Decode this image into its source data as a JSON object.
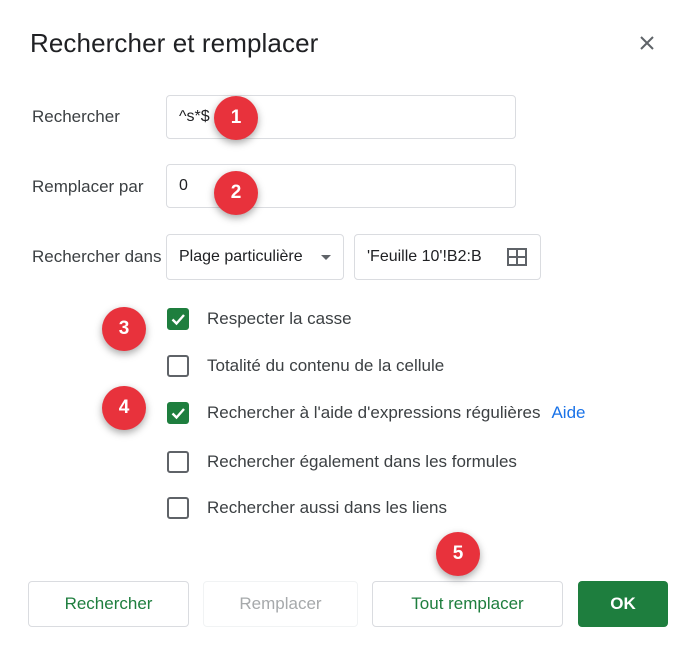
{
  "dialog": {
    "title": "Rechercher et remplacer",
    "close_icon": "close-icon"
  },
  "find": {
    "label": "Rechercher",
    "value": "^s*$"
  },
  "replace": {
    "label": "Remplacer par",
    "value": "0"
  },
  "search_in": {
    "label": "Rechercher dans",
    "selected_option": "Plage particulière",
    "range_value": "'Feuille 10'!B2:B",
    "range_icon": "grid-icon"
  },
  "options": [
    {
      "label": "Respecter la casse",
      "checked": true
    },
    {
      "label": "Totalité du contenu de la cellule",
      "checked": false
    },
    {
      "label": "Rechercher à l'aide d'expressions régulières",
      "checked": true,
      "link": "Aide"
    },
    {
      "label": "Rechercher également dans les formules",
      "checked": false
    },
    {
      "label": "Rechercher aussi dans les liens",
      "checked": false
    }
  ],
  "buttons": {
    "find": "Rechercher",
    "replace": "Remplacer",
    "replace_all": "Tout remplacer",
    "ok": "OK"
  },
  "markers": [
    "1",
    "2",
    "3",
    "4",
    "5"
  ],
  "colors": {
    "accent_green": "#1e7e3e",
    "link_blue": "#1a73e8",
    "marker_red": "#e8323c"
  }
}
